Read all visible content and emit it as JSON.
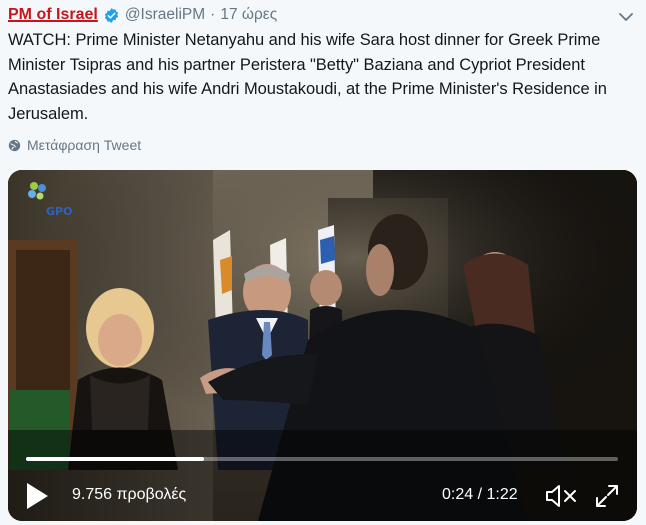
{
  "tweet": {
    "display_name": "PM of Israel",
    "handle": "@IsraeliPM",
    "separator": "·",
    "time": "17 ώρες",
    "text": "WATCH: Prime Minister Netanyahu and his wife Sara  host dinner for Greek Prime Minister Tsipras and his partner Peristera \"Betty\" Baziana and Cypriot President Anastasiades and his wife Andri Moustakoudi, at the Prime Minister's Residence in Jerusalem.",
    "translate_label": "Μετάφραση Tweet"
  },
  "video": {
    "watermark": "GPO",
    "views": "9.756 προβολές",
    "time_display": "0:24 / 1:22",
    "progress_fraction": 0.3
  },
  "icons": {
    "verified": "verified-badge-icon",
    "menu": "chevron-down-icon",
    "translate": "globe-icon",
    "play": "play-icon",
    "mute": "volume-muted-icon",
    "fullscreen": "fullscreen-icon"
  },
  "colors": {
    "name": "#c4161c",
    "verified": "#1da1f2",
    "secondary_text": "#657786",
    "background": "#f5f8fa"
  }
}
